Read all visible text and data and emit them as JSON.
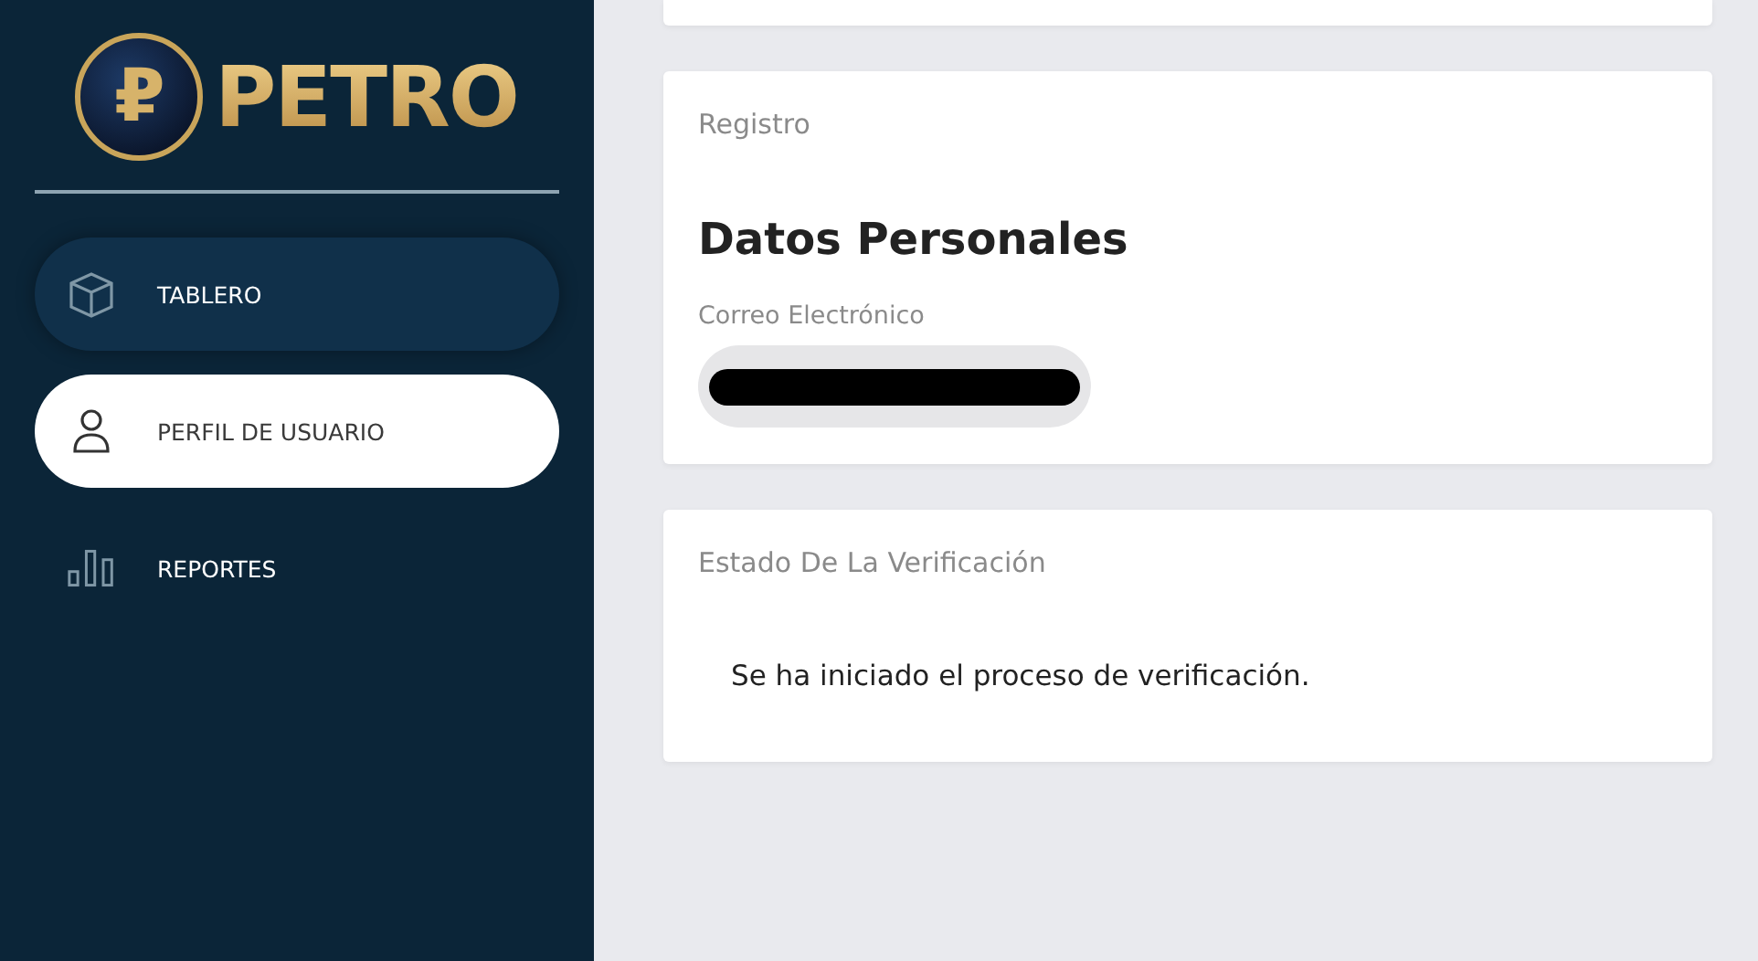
{
  "sidebar": {
    "logo": {
      "text": "PETRO",
      "emblem": "₽"
    },
    "items": [
      {
        "label": "TABLERO",
        "kind": "cube",
        "selected": false,
        "hovered": true
      },
      {
        "label": "PERFIL DE USUARIO",
        "kind": "user",
        "selected": true,
        "hovered": false
      },
      {
        "label": "REPORTES",
        "kind": "bars",
        "selected": false,
        "hovered": false
      }
    ]
  },
  "cards": [
    {
      "kind": "stub"
    },
    {
      "kind": "form",
      "caption": "Registro",
      "title": "Datos Personales",
      "field": {
        "label": "Correo Electrónico",
        "redacted": true
      }
    },
    {
      "kind": "status",
      "caption": "Estado De La Verificación",
      "message": "Se ha iniciado el proceso de verificación."
    }
  ]
}
